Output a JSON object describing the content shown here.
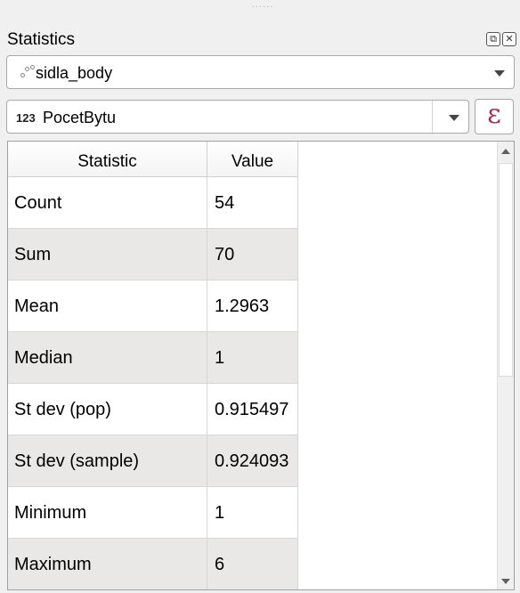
{
  "panel": {
    "title": "Statistics",
    "float_icon": "float-panel-icon",
    "close_icon": "close-panel-icon"
  },
  "layer_select": {
    "icon": "point-layer-icon",
    "value": "sidla_body"
  },
  "field_select": {
    "type_badge": "123",
    "value": "PocetBytu",
    "expression_icon": "ε"
  },
  "table": {
    "headers": {
      "statistic": "Statistic",
      "value": "Value"
    },
    "rows": [
      {
        "statistic": "Count",
        "value": "54"
      },
      {
        "statistic": "Sum",
        "value": "70"
      },
      {
        "statistic": "Mean",
        "value": "1.2963"
      },
      {
        "statistic": "Median",
        "value": "1"
      },
      {
        "statistic": "St dev (pop)",
        "value": "0.915497"
      },
      {
        "statistic": "St dev (sample)",
        "value": "0.924093"
      },
      {
        "statistic": "Minimum",
        "value": "1"
      },
      {
        "statistic": "Maximum",
        "value": "6"
      }
    ]
  },
  "colors": {
    "panel_bg": "#f0f0f0",
    "alt_row": "#e9e8e6",
    "expression_accent": "#a0315a"
  }
}
